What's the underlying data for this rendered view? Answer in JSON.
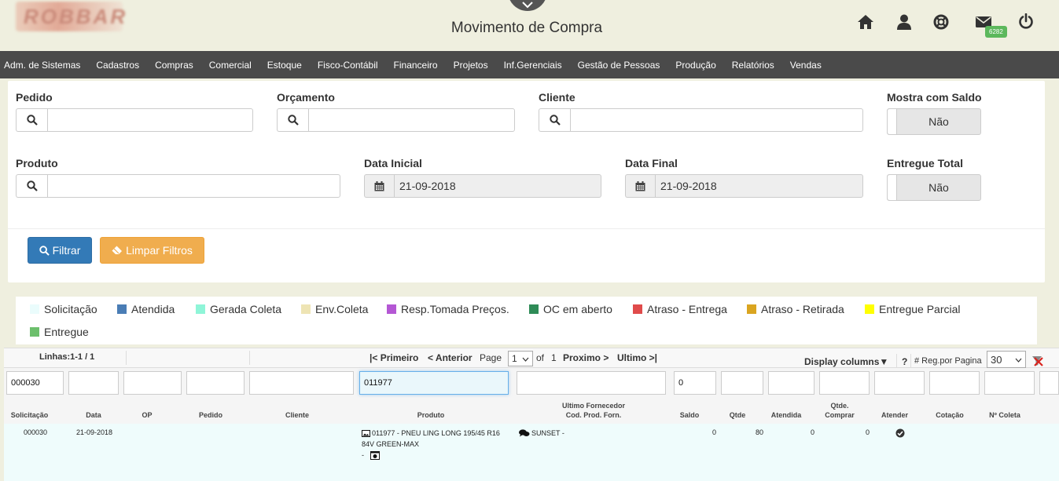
{
  "header": {
    "title": "Movimento de Compra",
    "logo_text": "ROBBAR",
    "icons": [
      "home-icon",
      "user-icon",
      "support-icon",
      "mail-icon",
      "power-icon"
    ],
    "mail_badge": "6282"
  },
  "nav": {
    "items": [
      "Adm. de Sistemas",
      "Cadastros",
      "Compras",
      "Comercial",
      "Estoque",
      "Fisco-Contábil",
      "Financeiro",
      "Projetos",
      "Inf.Gerenciais",
      "Gestão de Pessoas",
      "Produção",
      "Relatórios",
      "Vendas"
    ]
  },
  "filters": {
    "pedido_label": "Pedido",
    "orcamento_label": "Orçamento",
    "cliente_label": "Cliente",
    "mostra_saldo_label": "Mostra com Saldo",
    "mostra_saldo_value": "Não",
    "produto_label": "Produto",
    "data_inicial_label": "Data Inicial",
    "data_inicial_value": "21-09-2018",
    "data_final_label": "Data Final",
    "data_final_value": "21-09-2018",
    "entregue_total_label": "Entregue Total",
    "entregue_total_value": "Não",
    "filtrar_label": "Filtrar",
    "limpar_label": "Limpar Filtros"
  },
  "legend": [
    {
      "label": "Solicitação",
      "color": "#eafcfc"
    },
    {
      "label": "Atendida",
      "color": "#4a7db5"
    },
    {
      "label": "Gerada Coleta",
      "color": "#8ff5d8"
    },
    {
      "label": "Env.Coleta",
      "color": "#eee4b4"
    },
    {
      "label": "Resp.Tomada Preços.",
      "color": "#b457d4"
    },
    {
      "label": "OC em aberto",
      "color": "#2e8b57"
    },
    {
      "label": "Atraso - Entrega",
      "color": "#e04b4b"
    },
    {
      "label": "Atraso - Retirada",
      "color": "#daa520"
    },
    {
      "label": "Entregue Parcial",
      "color": "#ffff00"
    },
    {
      "label": "Entregue",
      "color": "#6cbf6c"
    }
  ],
  "pager": {
    "lines": "Linhas:1-1 / 1",
    "first": "|< Primeiro",
    "prev": "< Anterior",
    "page_label": "Page",
    "page_value": "1",
    "of_label": "of",
    "total_pages": "1",
    "next": "Proximo >",
    "last": "Ultimo >|",
    "display_columns": "Display columns▼",
    "help": "?",
    "reg_label": "# Reg.por Pagina",
    "reg_value": "30"
  },
  "filter_row": {
    "solicitacao": "000030",
    "produto": "011977",
    "saldo": "0"
  },
  "columns": {
    "solicitacao": "Solicitação",
    "data": "Data",
    "op": "OP",
    "pedido": "Pedido",
    "cliente": "Cliente",
    "produto": "Produto",
    "ultimo_fornecedor": "Ultimo Fornecedor",
    "cod_prod_forn": "Cod. Prod. Forn.",
    "saldo": "Saldo",
    "qtde": "Qtde",
    "atendida": "Atendida",
    "qtde_comprar_1": "Qtde.",
    "qtde_comprar_2": "Comprar",
    "atender": "Atender",
    "cotacao": "Cotação",
    "n_coleta": "Nº Coleta"
  },
  "rows": [
    {
      "solicitacao": "000030",
      "data": "21-09-2018",
      "produto_line1": "011977 - PNEU LING LONG 195/45 R16",
      "produto_line2": "84V GREEN-MAX",
      "produto_line3": "-",
      "fornecedor": "SUNSET -",
      "saldo": "0",
      "qtde": "80",
      "atendida": "0",
      "qtde_comprar": "0"
    }
  ]
}
